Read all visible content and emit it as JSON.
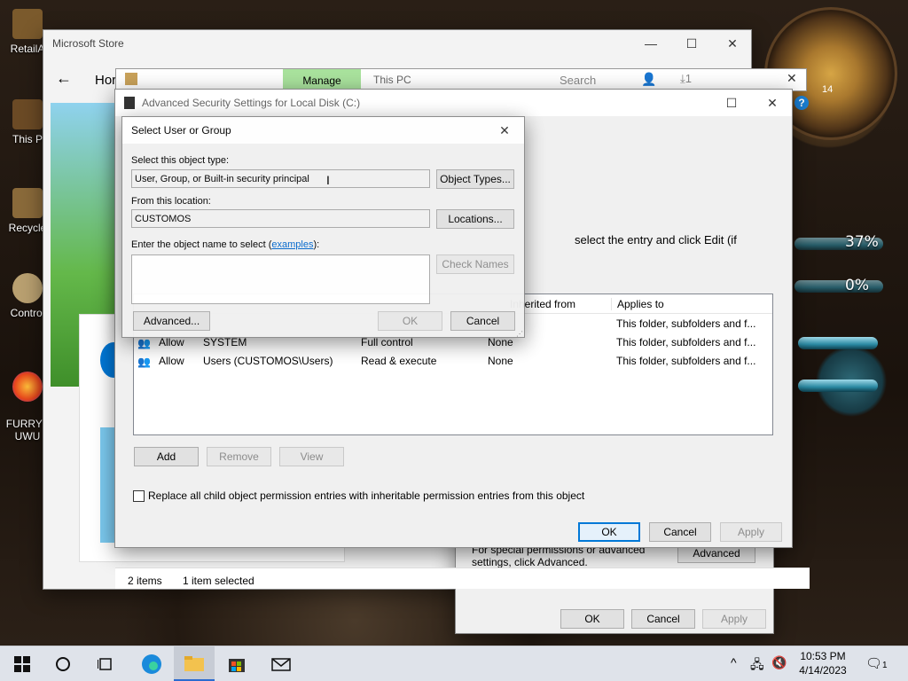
{
  "desktop": {
    "icons": [
      {
        "label": "RetailA"
      },
      {
        "label": "This P"
      },
      {
        "label": "Recycle"
      },
      {
        "label": "Control"
      },
      {
        "label": "FURRYF\nUWU"
      }
    ],
    "gauge1": "37%",
    "gauge2": "0%",
    "clock_num": "14"
  },
  "store_window": {
    "title": "Microsoft Store",
    "home_label": "Hor",
    "status_items": "2 items",
    "status_selected": "1 item selected"
  },
  "explorer": {
    "manage_tab": "Manage",
    "path": "This PC",
    "search": "Search",
    "pin": "1"
  },
  "props_window": {
    "ok": "OK",
    "cancel": "Cancel",
    "apply": "Apply",
    "advanced": "Advanced",
    "note": "For special permissions or advanced settings, click Advanced."
  },
  "adv_window": {
    "title": "Advanced Security Settings for Local Disk (C:)",
    "instruction": "select the entry and click Edit (if",
    "columns": {
      "inherited": "Inherited from",
      "applies": "Applies to"
    },
    "rows": [
      {
        "type": "",
        "principal": "",
        "access": "",
        "inherited": "",
        "applies": "This folder, subfolders and f..."
      },
      {
        "type": "Allow",
        "principal": "SYSTEM",
        "access": "Full control",
        "inherited": "None",
        "applies": "This folder, subfolders and f..."
      },
      {
        "type": "Allow",
        "principal": "Users (CUSTOMOS\\Users)",
        "access": "Read & execute",
        "inherited": "None",
        "applies": "This folder, subfolders and f..."
      }
    ],
    "add": "Add",
    "remove": "Remove",
    "view": "View",
    "replace_label": "Replace all child object permission entries with inheritable permission entries from this object",
    "ok": "OK",
    "cancel": "Cancel",
    "apply": "Apply"
  },
  "dialog": {
    "title": "Select User or Group",
    "object_type_label": "Select this object type:",
    "object_type_value": "User, Group, or Built-in security principal",
    "object_types_btn": "Object Types...",
    "location_label": "From this location:",
    "location_value": "CUSTOMOS",
    "locations_btn": "Locations...",
    "name_label_pre": "Enter the object name to select (",
    "name_label_link": "examples",
    "name_label_post": "):",
    "check_names_btn": "Check Names",
    "advanced_btn": "Advanced...",
    "ok_btn": "OK",
    "cancel_btn": "Cancel"
  },
  "taskbar": {
    "time": "10:53 PM",
    "date": "4/14/2023",
    "notif_count": "1"
  }
}
